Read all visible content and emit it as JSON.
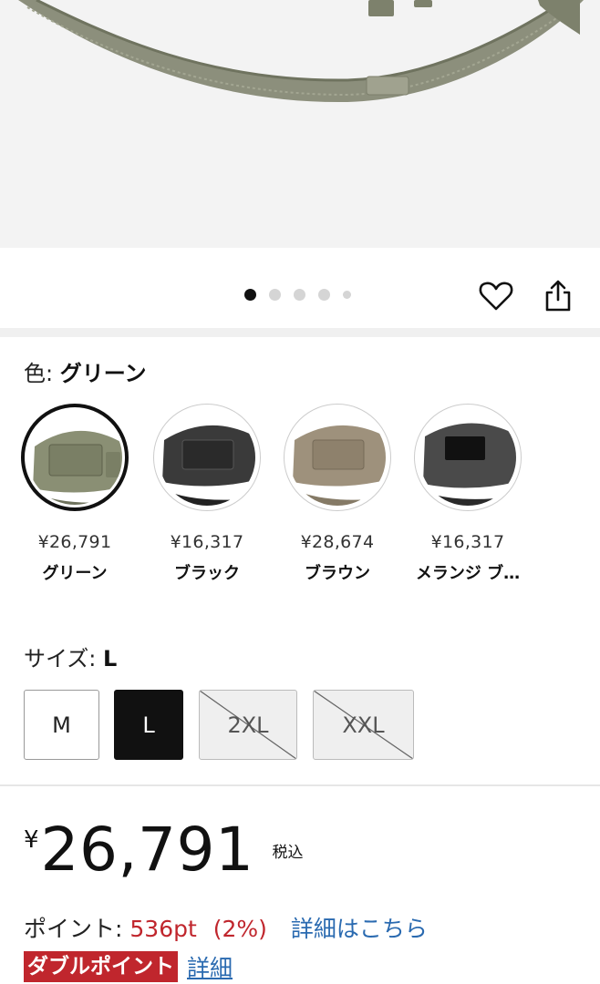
{
  "hero": {
    "image": "product-bag-strap-photo"
  },
  "gallery": {
    "dot_count": 5,
    "active_index": 0,
    "favorite_icon": "heart-icon",
    "share_icon": "share-icon"
  },
  "color": {
    "label": "色:",
    "selected": "グリーン",
    "options": [
      {
        "price": "¥26,791",
        "name": "グリーン",
        "tone": "#8a8f74"
      },
      {
        "price": "¥16,317",
        "name": "ブラック",
        "tone": "#3a3a3a"
      },
      {
        "price": "¥28,674",
        "name": "ブラウン",
        "tone": "#9e917c"
      },
      {
        "price": "¥16,317",
        "name": "メランジ ブ…",
        "tone": "#4a4a4a"
      }
    ]
  },
  "size": {
    "label": "サイズ:",
    "selected": "L",
    "options": [
      {
        "label": "M",
        "state": "available"
      },
      {
        "label": "L",
        "state": "selected"
      },
      {
        "label": "2XL",
        "state": "unavailable"
      },
      {
        "label": "XXL",
        "state": "unavailable"
      }
    ]
  },
  "price": {
    "currency": "¥",
    "amount": "26,791",
    "tax_note": "税込"
  },
  "points": {
    "label": "ポイント:",
    "value": "536pt",
    "percent": "(2%)",
    "link": "詳細はこちら"
  },
  "double_point": {
    "badge": "ダブルポイント",
    "link": "詳細"
  },
  "colors": {
    "accent_red": "#c0262d",
    "link_blue": "#2a6ab0"
  }
}
